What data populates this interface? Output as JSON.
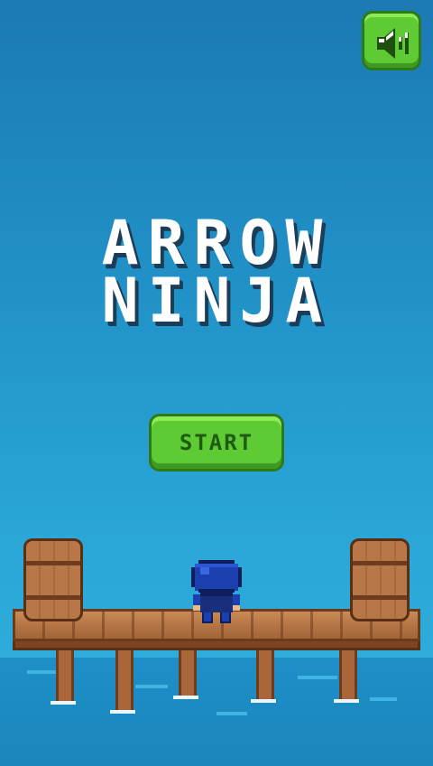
{
  "game": {
    "title_line1": "ARROW",
    "title_line2": "NINJA",
    "start_label": "START",
    "sound_state": "on"
  },
  "icons": {
    "sound": "speaker-icon"
  },
  "colors": {
    "sky_top": "#1c79b4",
    "sky_bottom": "#33b1de",
    "button_green": "#5ecb35",
    "button_border": "#2c7a18",
    "button_text": "#1f5b10",
    "title_text": "#ffffff",
    "title_shadow": "#1b3d58",
    "wood": "#b57545",
    "wood_dark": "#6b3b1c",
    "ninja_blue": "#1b3fae"
  }
}
